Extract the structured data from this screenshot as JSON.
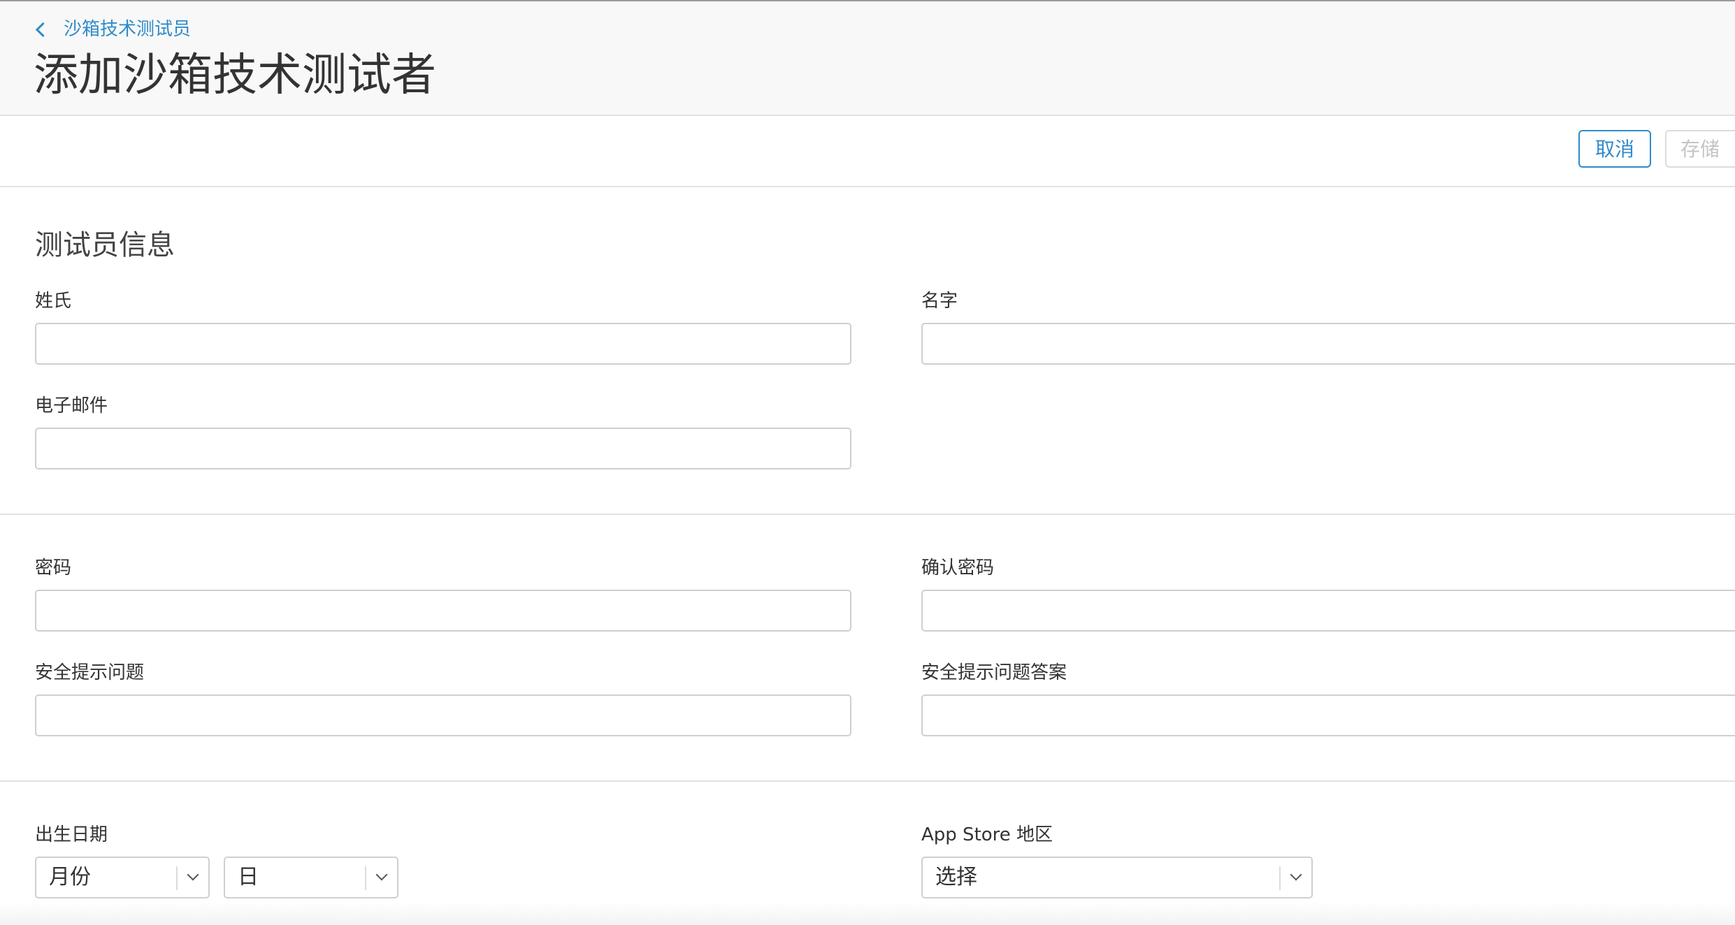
{
  "header": {
    "breadcrumb": "沙箱技术测试员",
    "title": "添加沙箱技术测试者"
  },
  "toolbar": {
    "cancel_label": "取消",
    "save_label": "存储"
  },
  "form": {
    "section_title": "测试员信息",
    "last_name": {
      "label": "姓氏",
      "value": ""
    },
    "first_name": {
      "label": "名字",
      "value": ""
    },
    "email": {
      "label": "电子邮件",
      "value": ""
    },
    "password": {
      "label": "密码",
      "value": ""
    },
    "confirm_password": {
      "label": "确认密码",
      "value": ""
    },
    "security_question": {
      "label": "安全提示问题",
      "value": ""
    },
    "security_answer": {
      "label": "安全提示问题答案",
      "value": ""
    },
    "birth_date": {
      "label": "出生日期",
      "month_selected": "月份",
      "day_selected": "日"
    },
    "store_region": {
      "label": "App Store 地区",
      "selected": "选择"
    }
  },
  "colors": {
    "accent": "#2f8bc9",
    "disabled": "#c4c4c4",
    "border": "#cfcfcf"
  }
}
